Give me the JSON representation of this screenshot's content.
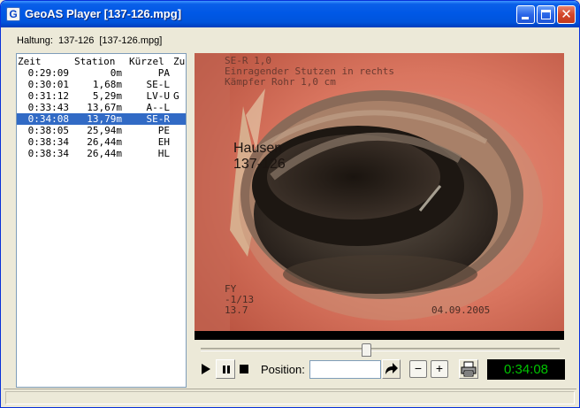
{
  "window": {
    "title": "GeoAS Player [137-126.mpg]",
    "app_icon_letter": "G",
    "close_glyph": "✕"
  },
  "header": {
    "haltung_label": "Haltung:",
    "haltung_id": "137-126",
    "haltung_file": "[137-126.mpg]"
  },
  "event_list": {
    "columns": [
      "Zeit",
      "Station",
      "Kürzel",
      "Zu"
    ],
    "rows": [
      {
        "zeit": "0:29:09",
        "station": "0m",
        "kuerzel": "PA",
        "extra": "",
        "selected": false
      },
      {
        "zeit": "0:30:01",
        "station": "1,68m",
        "kuerzel": "SE-L",
        "extra": "",
        "selected": false
      },
      {
        "zeit": "0:31:12",
        "station": "5,29m",
        "kuerzel": "LV-U",
        "extra": "G",
        "selected": false
      },
      {
        "zeit": "0:33:43",
        "station": "13,67m",
        "kuerzel": "A--L",
        "extra": "",
        "selected": false
      },
      {
        "zeit": "0:34:08",
        "station": "13,79m",
        "kuerzel": "SE-R",
        "extra": "",
        "selected": true
      },
      {
        "zeit": "0:38:05",
        "station": "25,94m",
        "kuerzel": "PE",
        "extra": "",
        "selected": false
      },
      {
        "zeit": "0:38:34",
        "station": "26,44m",
        "kuerzel": "EH",
        "extra": "",
        "selected": false
      },
      {
        "zeit": "0:38:34",
        "station": "26,44m",
        "kuerzel": "HL",
        "extra": "",
        "selected": false
      }
    ]
  },
  "video": {
    "overlay_line1": "SE-R  1,0",
    "overlay_line2": "Einragender Stutzen in rechts",
    "overlay_line3": "Kämpfer  Rohr 1,0 cm",
    "location_name": "Hausen",
    "location_id": "137-126",
    "bottom_left_1": "FY",
    "bottom_left_2": "-1/13",
    "bottom_left_3": "13.7",
    "date_stamp": "04.09.2005"
  },
  "playback": {
    "progress_fraction": 0.46,
    "position_label": "Position:",
    "position_value": "",
    "minus_label": "−",
    "plus_label": "+",
    "current_time": "0:34:08"
  },
  "colors": {
    "titlebar": "#0054dc",
    "selection": "#316ac5",
    "time_display_text": "#00c400"
  }
}
